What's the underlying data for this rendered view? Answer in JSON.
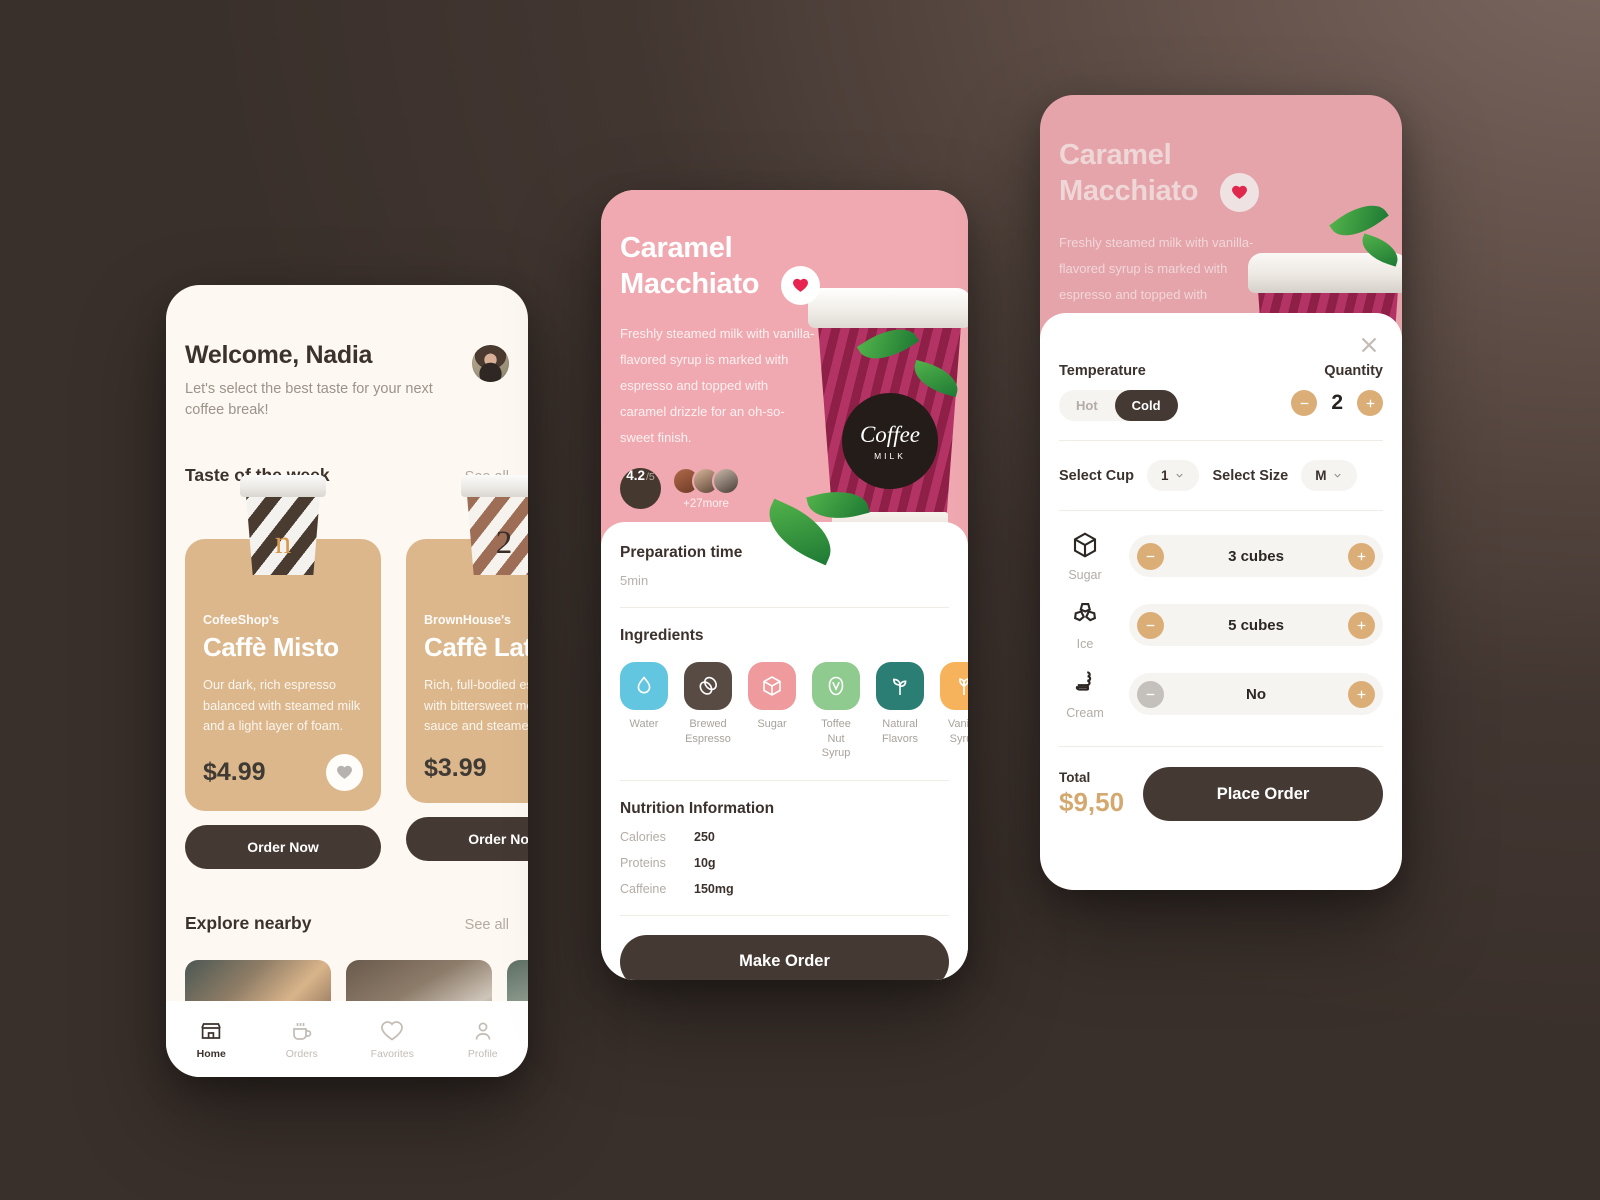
{
  "home": {
    "greeting": "Welcome, Nadia",
    "subtitle": "Let's select the best taste for your next coffee break!",
    "avatar_icon": "user-avatar",
    "sections": {
      "taste": {
        "title": "Taste of the week",
        "see_all": "See all"
      },
      "explore": {
        "title": "Explore nearby",
        "see_all": "See all"
      }
    },
    "products": [
      {
        "shop": "CofeeShop's",
        "name": "Caffè Misto",
        "desc": "Our dark, rich espresso balanced with steamed milk and a light layer of foam.",
        "price": "$4.99",
        "cup_mark": "n",
        "order_label": "Order Now",
        "fav_icon": "heart-icon"
      },
      {
        "shop": "BrownHouse's",
        "name": "Caffè Latte",
        "desc": "Rich, full-bodied espresso with bittersweet mocha sauce and steamed milk.",
        "price": "$3.99",
        "cup_mark": "2",
        "order_label": "Order Now",
        "fav_icon": "heart-icon"
      }
    ],
    "tabs": [
      {
        "label": "Home",
        "icon": "store-icon",
        "active": true
      },
      {
        "label": "Orders",
        "icon": "cup-icon",
        "active": false
      },
      {
        "label": "Favorites",
        "icon": "heart-outline-icon",
        "active": false
      },
      {
        "label": "Profile",
        "icon": "person-icon",
        "active": false
      }
    ]
  },
  "detail": {
    "title_line1": "Caramel",
    "title_line2": "Macchiato",
    "favorite_icon": "heart-filled-icon",
    "description": "Freshly steamed milk with vanilla-flavored syrup is marked with espresso and topped with caramel drizzle for an oh-so-sweet finish.",
    "rating": {
      "value": "4.2",
      "max": "/5",
      "more": "+27more"
    },
    "prep": {
      "title": "Preparation time",
      "value": "5min"
    },
    "ingredients_title": "Ingredients",
    "ingredients": [
      {
        "label": "Water",
        "color": "#62c6e0",
        "icon": "water-drop-icon"
      },
      {
        "label": "Brewed Espresso",
        "color": "#584b43",
        "icon": "coffee-bean-icon"
      },
      {
        "label": "Sugar",
        "color": "#ef9a9c",
        "icon": "sugar-cube-icon"
      },
      {
        "label": "Toffee Nut Syrup",
        "color": "#8fcb8e",
        "icon": "nut-icon"
      },
      {
        "label": "Natural Flavors",
        "color": "#2a7e73",
        "icon": "leaf-sprout-icon"
      },
      {
        "label": "Vanilla Syrup",
        "color": "#f7b35c",
        "icon": "vanilla-flower-icon"
      }
    ],
    "nutrition_title": "Nutrition Information",
    "nutrition": [
      {
        "key": "Calories",
        "value": "250"
      },
      {
        "key": "Proteins",
        "value": "10g"
      },
      {
        "key": "Caffeine",
        "value": "150mg"
      }
    ],
    "cta": "Make Order",
    "cup_logo_main": "Coffee",
    "cup_logo_sub": "MILK"
  },
  "customize": {
    "title_line1": "Caramel",
    "title_line2": "Macchiato",
    "favorite_icon": "heart-filled-icon",
    "description": "Freshly steamed milk with vanilla-flavored syrup is marked with espresso and topped with caramel drizzle",
    "close_icon": "close-icon",
    "temperature": {
      "label": "Temperature",
      "options": [
        {
          "label": "Hot",
          "selected": false
        },
        {
          "label": "Cold",
          "selected": true
        }
      ]
    },
    "quantity": {
      "label": "Quantity",
      "value": "2",
      "minus_icon": "minus-icon",
      "plus_icon": "plus-icon"
    },
    "select_cup": {
      "label": "Select Cup",
      "value": "1",
      "chevron_icon": "chevron-down-icon"
    },
    "select_size": {
      "label": "Select Size",
      "value": "M",
      "chevron_icon": "chevron-down-icon"
    },
    "addons": [
      {
        "name": "Sugar",
        "value": "3 cubes",
        "icon": "sugar-cube-icon",
        "minus_enabled": true
      },
      {
        "name": "Ice",
        "value": "5 cubes",
        "icon": "ice-cubes-icon",
        "minus_enabled": true
      },
      {
        "name": "Cream",
        "value": "No",
        "icon": "cream-swirl-icon",
        "minus_enabled": false
      }
    ],
    "total": {
      "label": "Total",
      "value": "$9,50"
    },
    "cta": "Place Order"
  },
  "colors": {
    "dark_brown": "#453a33",
    "card_tan": "#dcb78c",
    "accent_tan": "#dcae77",
    "pink": "#f0a9b0",
    "gold": "#d4a96f",
    "heart_red": "#e7244f"
  }
}
